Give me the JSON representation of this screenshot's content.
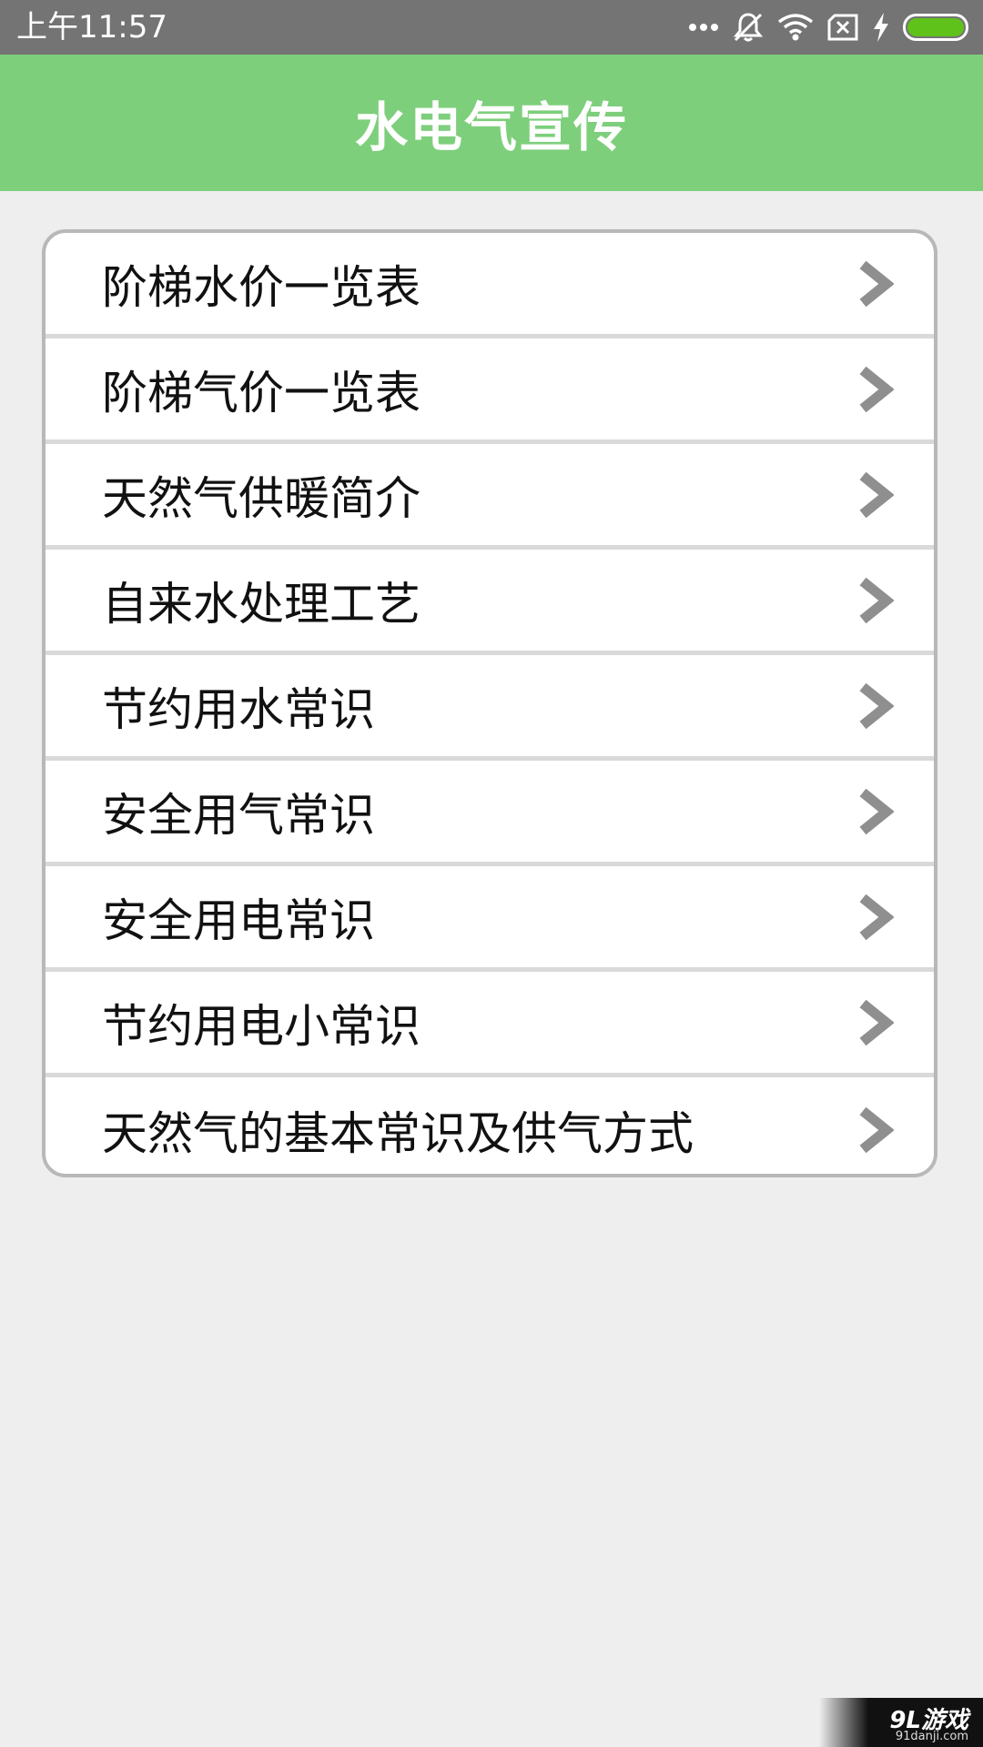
{
  "status_bar": {
    "time": "上午11:57",
    "icons": [
      "more-dots-icon",
      "mute-icon",
      "wifi-icon",
      "sim-off-icon",
      "charging-icon",
      "battery-icon"
    ],
    "battery_color": "#5ec21a"
  },
  "header": {
    "title": "水电气宣传",
    "color": "#7ecf7c"
  },
  "menu": {
    "items": [
      {
        "label": "阶梯水价一览表"
      },
      {
        "label": "阶梯气价一览表"
      },
      {
        "label": "天然气供暖简介"
      },
      {
        "label": "自来水处理工艺"
      },
      {
        "label": "节约用水常识"
      },
      {
        "label": "安全用气常识"
      },
      {
        "label": "安全用电常识"
      },
      {
        "label": "节约用电小常识"
      },
      {
        "label": "天然气的基本常识及供气方式"
      }
    ]
  },
  "watermark": {
    "main": "9L游戏",
    "sub": "91danji.com"
  }
}
